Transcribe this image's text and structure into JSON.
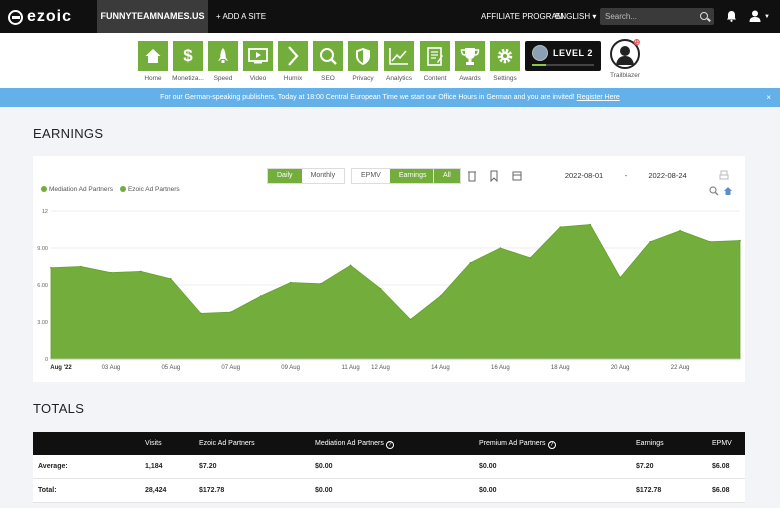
{
  "topbar": {
    "logo": "ezoic",
    "site_name": "FUNNYTEAMNAMES.US",
    "add_site": "+ ADD A SITE",
    "affiliate": "AFFILIATE PROGRAM",
    "language": "ENGLISH ▾",
    "search_placeholder": "Search..."
  },
  "nav": {
    "items": [
      {
        "label": "Home",
        "icon": "home-icon"
      },
      {
        "label": "Monetiza...",
        "icon": "dollar-icon"
      },
      {
        "label": "Speed",
        "icon": "rocket-icon"
      },
      {
        "label": "Video",
        "icon": "video-icon"
      },
      {
        "label": "Humix",
        "icon": "chevron-icon"
      },
      {
        "label": "SEO",
        "icon": "magnifier-icon"
      },
      {
        "label": "Privacy",
        "icon": "shield-icon"
      },
      {
        "label": "Analytics",
        "icon": "chart-icon"
      },
      {
        "label": "Content",
        "icon": "document-icon"
      },
      {
        "label": "Awards",
        "icon": "trophy-icon"
      },
      {
        "label": "Settings",
        "icon": "gear-icon"
      }
    ],
    "level": "LEVEL 2",
    "level_progress": 0.22,
    "trailblazer": "Trailblazer"
  },
  "banner": {
    "text": "For our German-speaking publishers, Today at 18:00 Central European Time we start our Office Hours in German and you are invited!",
    "link": "Register Here",
    "close": "×"
  },
  "earnings": {
    "title": "EARNINGS",
    "period_tabs": [
      "Daily",
      "Monthly"
    ],
    "active_period": "Daily",
    "metric_tabs": [
      "EPMV",
      "Earnings"
    ],
    "active_metric": "Earnings",
    "all_label": "All",
    "date_from": "2022-08-01",
    "date_sep": "-",
    "date_to": "2022-08-24",
    "legend": [
      "Mediation Ad Partners",
      "Ezoic Ad Partners"
    ]
  },
  "chart_data": {
    "type": "area",
    "series": [
      {
        "name": "Ezoic Ad Partners",
        "values": [
          7.4,
          7.5,
          7.0,
          7.1,
          6.5,
          3.7,
          3.8,
          5.1,
          6.2,
          6.1,
          7.6,
          5.7,
          3.2,
          5.1,
          7.8,
          9.0,
          8.2,
          10.7,
          10.9,
          6.6,
          9.5,
          10.4,
          9.5,
          9.6
        ]
      },
      {
        "name": "Mediation Ad Partners",
        "values": [
          0,
          0,
          0,
          0,
          0,
          0,
          0,
          0,
          0,
          0,
          0,
          0,
          0,
          0,
          0,
          0,
          0,
          0,
          0,
          0,
          0,
          0,
          0,
          0
        ]
      }
    ],
    "x_tick_labels": [
      "Aug '22",
      "03 Aug",
      "05 Aug",
      "07 Aug",
      "09 Aug",
      "11 Aug",
      "12 Aug",
      "14 Aug",
      "16 Aug",
      "18 Aug",
      "20 Aug",
      "22 Aug"
    ],
    "x_tick_days": [
      1,
      3,
      5,
      7,
      9,
      11,
      12,
      14,
      16,
      18,
      20,
      22
    ],
    "y_tick_labels": [
      "0",
      "3.00",
      "6.00",
      "9.00",
      "12"
    ],
    "y_tick_values": [
      0,
      3,
      6,
      9,
      12
    ],
    "ylim": [
      0,
      12
    ],
    "x_range": [
      1,
      24
    ],
    "grid": true,
    "legend_position": "top-left",
    "color": "#73ad3b"
  },
  "totals": {
    "title": "TOTALS",
    "headers": [
      "",
      "Visits",
      "Ezoic Ad Partners",
      "Mediation Ad Partners",
      "Premium Ad Partners",
      "Earnings",
      "EPMV"
    ],
    "help_mark": "?",
    "rows": [
      [
        "Average:",
        "1,184",
        "$7.20",
        "$0.00",
        "$0.00",
        "$7.20",
        "$6.08"
      ],
      [
        "Total:",
        "28,424",
        "$172.78",
        "$0.00",
        "$0.00",
        "$172.78",
        "$6.08"
      ]
    ]
  }
}
